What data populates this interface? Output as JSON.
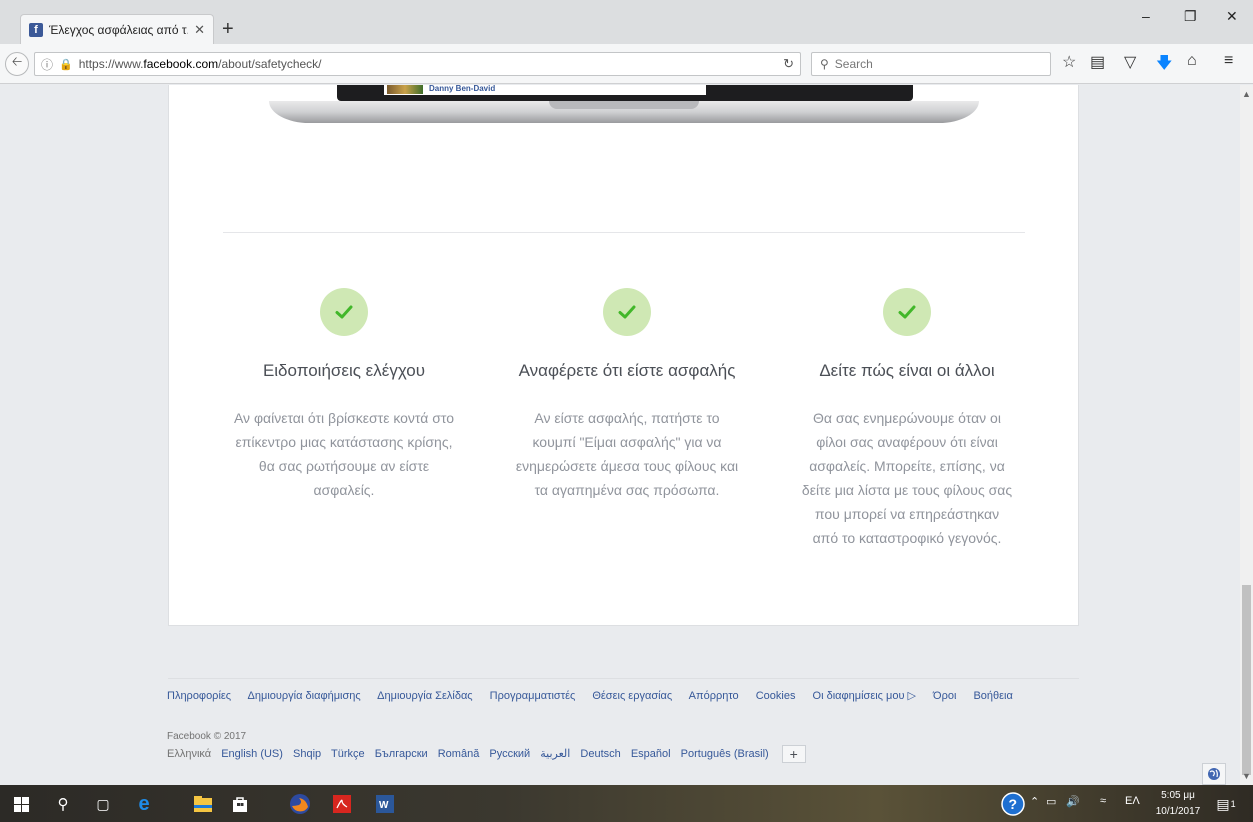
{
  "browser": {
    "tab_title": "Έλεγχος ασφάλειας από τ...",
    "tab_close": "✕",
    "new_tab": "+",
    "url_prefix": "https://www.",
    "url_domain": "facebook.com",
    "url_path": "/about/safetycheck/",
    "search_placeholder": "Search"
  },
  "laptop": {
    "post_name": "Danny Ben-David"
  },
  "features": [
    {
      "title": "Ειδοποιήσεις ελέγχου",
      "text": "Αν φαίνεται ότι βρίσκεστε κοντά στο επίκεντρο μιας κατάστασης κρίσης, θα σας ρωτήσουμε αν είστε ασφαλείς."
    },
    {
      "title": "Αναφέρετε ότι είστε ασφαλής",
      "text": "Αν είστε ασφαλής, πατήστε το κουμπί \"Είμαι ασφαλής\" για να ενημερώσετε άμεσα τους φίλους και τα αγαπημένα σας πρόσωπα."
    },
    {
      "title": "Δείτε πώς είναι οι άλλοι",
      "text": "Θα σας ενημερώνουμε όταν οι φίλοι σας αναφέρουν ότι είναι ασφαλείς. Μπορείτε, επίσης, να δείτε μια λίστα με τους φίλους σας που μπορεί να επηρεάστηκαν από το καταστροφικό γεγονός."
    }
  ],
  "footer": {
    "links": [
      "Πληροφορίες",
      "Δημιουργία διαφήμισης",
      "Δημιουργία Σελίδας",
      "Προγραμματιστές",
      "Θέσεις εργασίας",
      "Απόρρητο",
      "Cookies",
      "Οι διαφημίσεις μου",
      "Όροι",
      "Βοήθεια"
    ],
    "copyright": "Facebook © 2017",
    "current_language": "Ελληνικά",
    "languages": [
      "English (US)",
      "Shqip",
      "Türkçe",
      "Български",
      "Română",
      "Русский",
      "العربية",
      "Deutsch",
      "Español",
      "Português (Brasil)"
    ],
    "more_languages": "+"
  },
  "taskbar": {
    "time": "5:05 μμ",
    "date": "10/1/2017",
    "input_lang": "ΕΛ",
    "notification_count": "1"
  },
  "colors": {
    "check_circle": "#cfe8b4",
    "check_mark": "#42b72a",
    "link": "#365899"
  }
}
